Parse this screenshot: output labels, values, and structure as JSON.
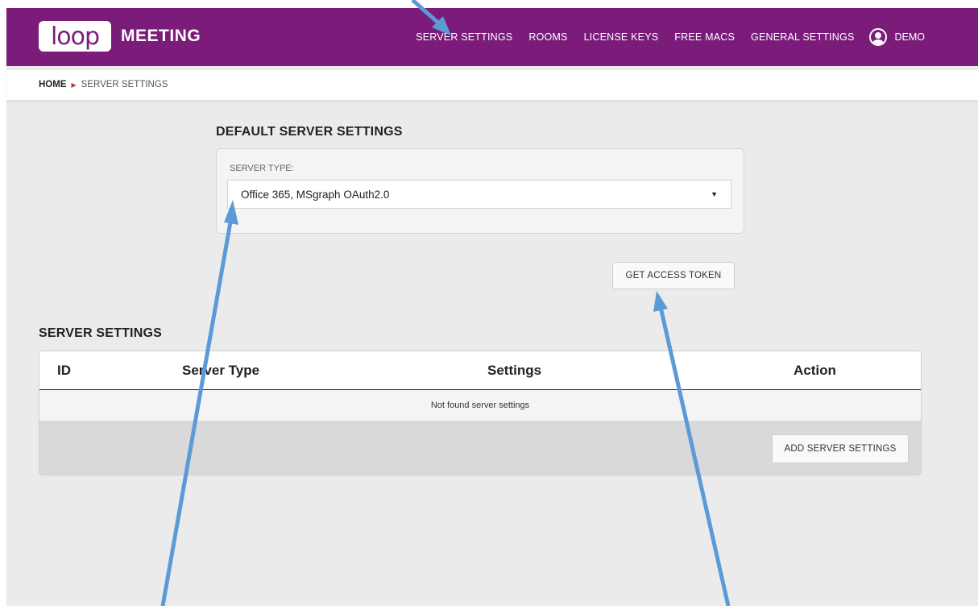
{
  "app": {
    "logo_text": "loop",
    "product_name": "MEETING"
  },
  "nav": {
    "items": [
      "SERVER SETTINGS",
      "ROOMS",
      "LICENSE KEYS",
      "FREE MACS",
      "GENERAL SETTINGS"
    ],
    "user": "DEMO"
  },
  "breadcrumb": {
    "home": "HOME",
    "current": "SERVER SETTINGS"
  },
  "default_settings": {
    "title": "DEFAULT SERVER SETTINGS",
    "server_type_label": "SERVER TYPE:",
    "server_type_value": "Office 365, MSgraph OAuth2.0",
    "access_token_button": "GET ACCESS TOKEN"
  },
  "server_settings": {
    "title": "SERVER SETTINGS",
    "columns": [
      "ID",
      "Server Type",
      "Settings",
      "Action"
    ],
    "empty_message": "Not found server settings",
    "add_button": "ADD SERVER SETTINGS"
  },
  "colors": {
    "brand": "#7b1c7b",
    "annotation_arrow": "#5b9bd5"
  }
}
